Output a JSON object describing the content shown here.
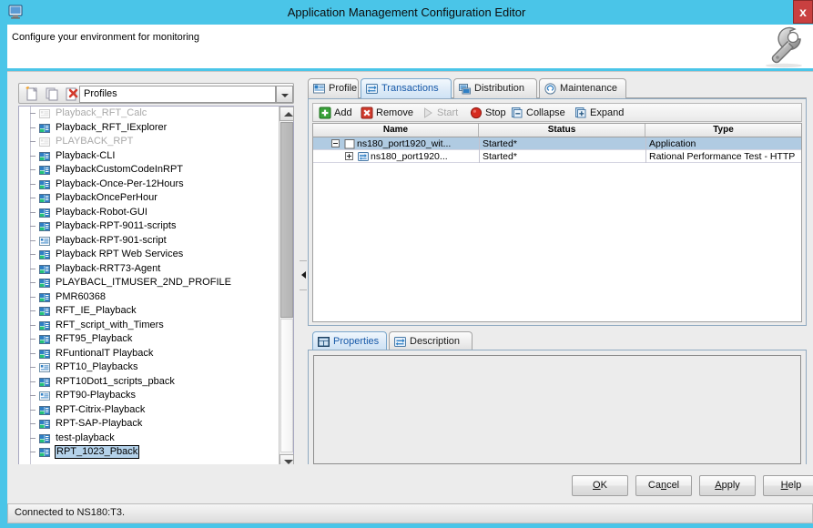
{
  "window": {
    "title": "Application Management Configuration Editor",
    "title_icon": "monitor-icon",
    "close_label": "x",
    "header_text": "Configure your environment for monitoring",
    "header_icon": "wrench-icon"
  },
  "profiles": {
    "toolbar": [
      {
        "name": "new-profile-icon",
        "tip": "New"
      },
      {
        "name": "copy-profile-icon",
        "tip": "Copy"
      },
      {
        "name": "delete-profile-icon",
        "tip": "Delete"
      }
    ],
    "combo_value": "Profiles",
    "combo_arrow_icon": "chevron-down-icon",
    "items": [
      {
        "label": "Playback_RFT_Calc",
        "icon": "script-icon",
        "dim": true,
        "selected": false
      },
      {
        "label": "Playback_RFT_IExplorer",
        "icon": "profile-icon",
        "dim": false,
        "selected": false
      },
      {
        "label": "PLAYBACK_RPT",
        "icon": "script-icon",
        "dim": true,
        "selected": false
      },
      {
        "label": "Playback-CLI",
        "icon": "profile-icon",
        "dim": false,
        "selected": false
      },
      {
        "label": "PlaybackCustomCodeInRPT",
        "icon": "profile-icon",
        "dim": false,
        "selected": false
      },
      {
        "label": "Playback-Once-Per-12Hours",
        "icon": "profile-icon",
        "dim": false,
        "selected": false
      },
      {
        "label": "PlaybackOncePerHour",
        "icon": "profile-icon",
        "dim": false,
        "selected": false
      },
      {
        "label": "Playback-Robot-GUI",
        "icon": "profile-icon",
        "dim": false,
        "selected": false
      },
      {
        "label": "Playback-RPT-9011-scripts",
        "icon": "profile-icon",
        "dim": false,
        "selected": false
      },
      {
        "label": "Playback-RPT-901-script",
        "icon": "script-icon",
        "dim": false,
        "selected": false
      },
      {
        "label": "Playback RPT Web Services",
        "icon": "profile-icon",
        "dim": false,
        "selected": false
      },
      {
        "label": "Playback-RRT73-Agent",
        "icon": "profile-icon",
        "dim": false,
        "selected": false
      },
      {
        "label": "PLAYBACL_ITMUSER_2ND_PROFILE",
        "icon": "profile-icon",
        "dim": false,
        "selected": false
      },
      {
        "label": "PMR60368",
        "icon": "profile-icon",
        "dim": false,
        "selected": false
      },
      {
        "label": "RFT_IE_Playback",
        "icon": "profile-icon",
        "dim": false,
        "selected": false
      },
      {
        "label": "RFT_script_with_Timers",
        "icon": "profile-icon",
        "dim": false,
        "selected": false
      },
      {
        "label": "RFT95_Playback",
        "icon": "profile-icon",
        "dim": false,
        "selected": false
      },
      {
        "label": "RFuntionalT Playback",
        "icon": "profile-icon",
        "dim": false,
        "selected": false
      },
      {
        "label": "RPT10_Playbacks",
        "icon": "script-icon",
        "dim": false,
        "selected": false
      },
      {
        "label": "RPT10Dot1_scripts_pback",
        "icon": "profile-icon",
        "dim": false,
        "selected": false
      },
      {
        "label": "RPT90-Playbacks",
        "icon": "script-icon",
        "dim": false,
        "selected": false
      },
      {
        "label": "RPT-Citrix-Playback",
        "icon": "profile-icon",
        "dim": false,
        "selected": false
      },
      {
        "label": "RPT-SAP-Playback",
        "icon": "profile-icon",
        "dim": false,
        "selected": false
      },
      {
        "label": "test-playback",
        "icon": "profile-icon",
        "dim": false,
        "selected": false
      },
      {
        "label": "RPT_1023_Pback",
        "icon": "profile-icon",
        "dim": false,
        "selected": true
      }
    ]
  },
  "splitter": {
    "collapse_icon": "collapse-left-icon"
  },
  "tabs": [
    {
      "label": "Profile",
      "icon": "profile-tab-icon",
      "active": false
    },
    {
      "label": "Transactions",
      "icon": "transactions-tab-icon",
      "active": true
    },
    {
      "label": "Distribution",
      "icon": "distribution-tab-icon",
      "active": false
    },
    {
      "label": "Maintenance",
      "icon": "maintenance-tab-icon",
      "active": false
    }
  ],
  "transactions": {
    "toolbar": [
      {
        "label": "Add",
        "icon": "add-icon",
        "disabled": false
      },
      {
        "label": "Remove",
        "icon": "remove-icon",
        "disabled": false
      },
      {
        "label": "Start",
        "icon": "start-icon",
        "disabled": true
      },
      {
        "label": "Stop",
        "icon": "stop-icon",
        "disabled": false
      },
      {
        "label": "Collapse",
        "icon": "collapse-icon",
        "disabled": false
      },
      {
        "label": "Expand",
        "icon": "expand-icon",
        "disabled": false
      }
    ],
    "columns": [
      "Name",
      "Status",
      "Type"
    ],
    "rows": [
      {
        "name": "ns180_port1920_wit...",
        "status": "Started*",
        "type": "Application",
        "expander": "minus",
        "icon": "checkbox-icon",
        "indent": 0,
        "selected": true
      },
      {
        "name": "ns180_port1920...",
        "status": "Started*",
        "type": "Rational Performance Test - HTTP",
        "expander": "plus",
        "icon": "transaction-icon",
        "indent": 1,
        "selected": false
      }
    ]
  },
  "properties": {
    "tabs": [
      {
        "label": "Properties",
        "icon": "properties-icon",
        "active": true
      },
      {
        "label": "Description",
        "icon": "description-icon",
        "active": false
      }
    ],
    "content": ""
  },
  "footer": {
    "buttons": [
      {
        "label": "OK",
        "mnemonic": "O",
        "name": "ok-button"
      },
      {
        "label": "Cancel",
        "mnemonic": "n",
        "name": "cancel-button"
      },
      {
        "label": "Apply",
        "mnemonic": "A",
        "name": "apply-button"
      },
      {
        "label": "Help",
        "mnemonic": "H",
        "name": "help-button"
      }
    ]
  },
  "status": {
    "text": "Connected to NS180:T3."
  },
  "colors": {
    "window_chrome": "#4ac5e8",
    "selection": "#b0cbe2",
    "accent_tab_text": "#1558a8",
    "close_button": "#c94040"
  }
}
